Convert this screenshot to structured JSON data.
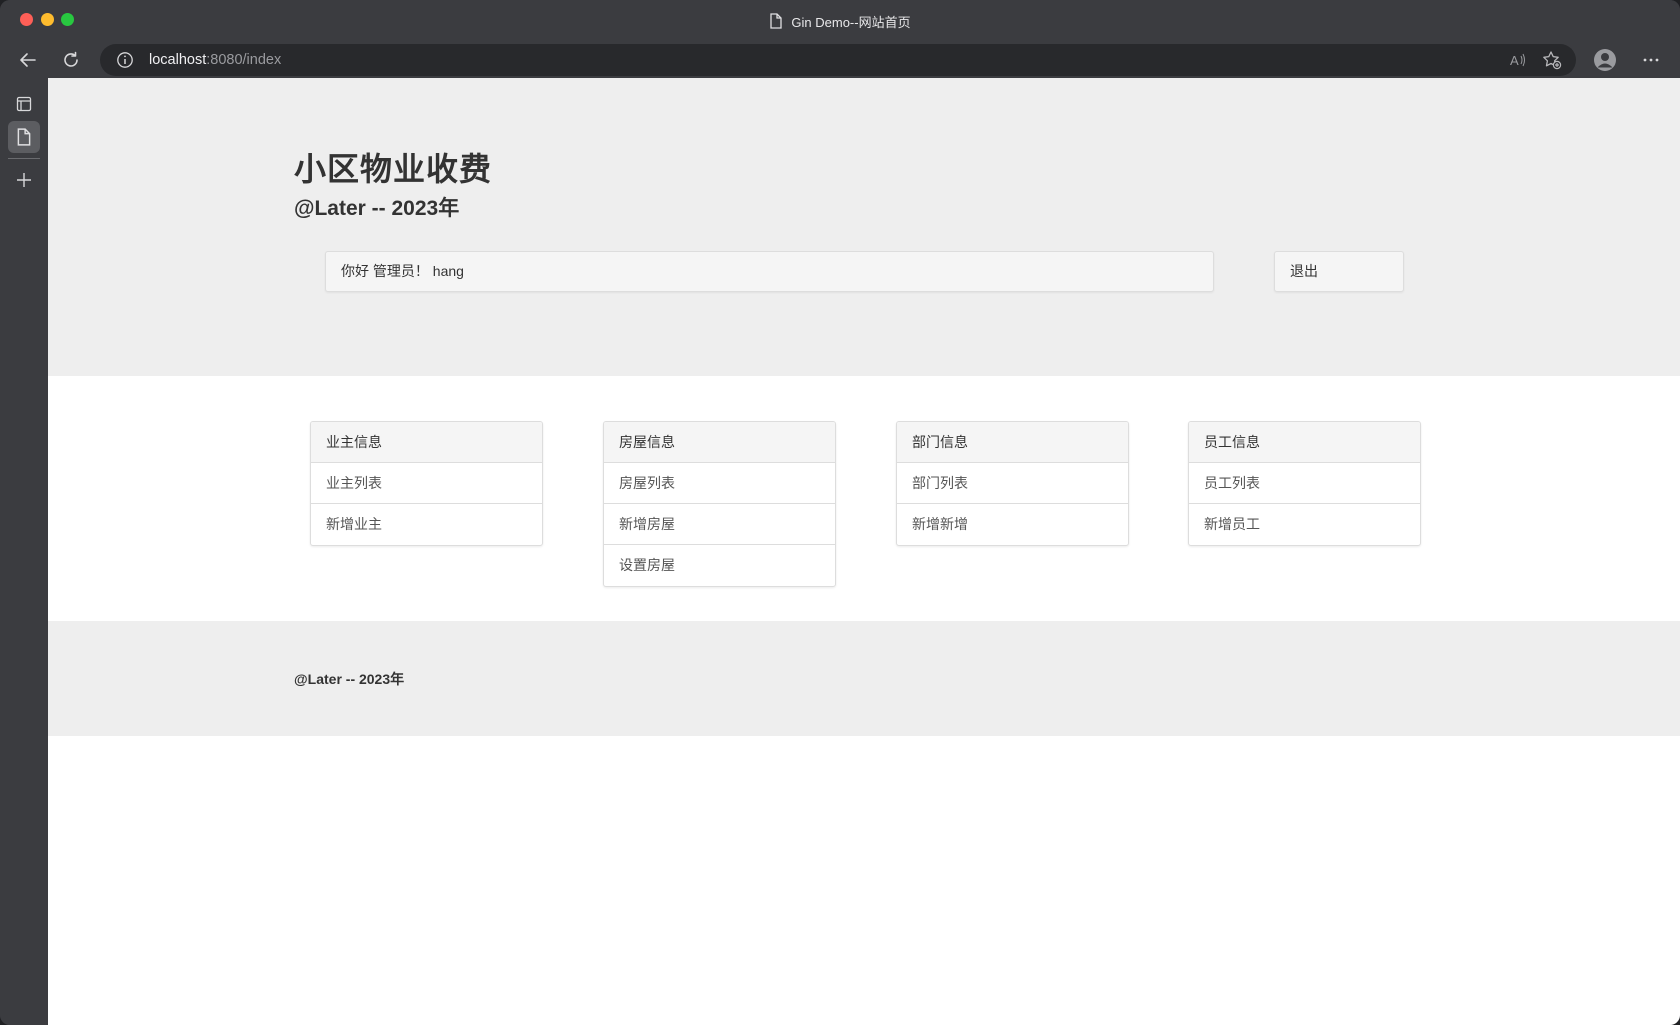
{
  "browser": {
    "tab_title": "Gin Demo--网站首页",
    "url_host": "localhost",
    "url_rest": ":8080/index"
  },
  "header": {
    "title": "小区物业收费",
    "subtitle": "@Later -- 2023年",
    "welcome": "你好 管理员！ hang",
    "logout_label": "退出"
  },
  "panels": [
    {
      "title": "业主信息",
      "items": [
        "业主列表",
        "新增业主"
      ]
    },
    {
      "title": "房屋信息",
      "items": [
        "房屋列表",
        "新增房屋",
        "设置房屋"
      ]
    },
    {
      "title": "部门信息",
      "items": [
        "部门列表",
        "新增新增"
      ]
    },
    {
      "title": "员工信息",
      "items": [
        "员工列表",
        "新增员工"
      ]
    }
  ],
  "footer": {
    "text": "@Later -- 2023年"
  },
  "colors": {
    "jumbotron_bg": "#eeeeee",
    "panel_head_bg": "#f5f5f5",
    "chrome_bg": "#3b3c40"
  },
  "icons": {
    "tab": "document-icon",
    "back": "back-arrow-icon",
    "reload": "reload-icon",
    "site_info": "info-icon",
    "read_aloud": "read-aloud-icon",
    "favorites": "add-favorite-icon",
    "profile": "profile-icon",
    "menu": "more-icon"
  }
}
